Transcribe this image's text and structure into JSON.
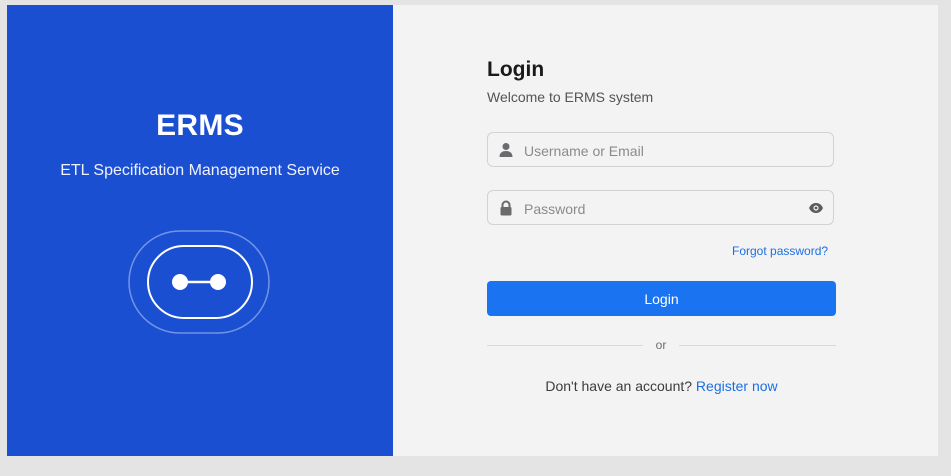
{
  "brand": {
    "name": "ERMS",
    "tagline": "ETL Specification Management Service"
  },
  "login": {
    "title": "Login",
    "subtitle": "Welcome to ERMS system",
    "username_placeholder": "Username or Email",
    "password_placeholder": "Password",
    "forgot_label": "Forgot password?",
    "button_label": "Login",
    "divider_text": "or",
    "register_prompt": "Don't have an account?",
    "register_link": "Register now"
  },
  "icons": {
    "user": "user-icon",
    "lock": "lock-icon",
    "eye": "eye-icon",
    "logo": "connector-logo-icon"
  },
  "colors": {
    "brand_panel": "#1b4fd2",
    "primary_button": "#1a73f0",
    "link": "#1d6fe0"
  }
}
